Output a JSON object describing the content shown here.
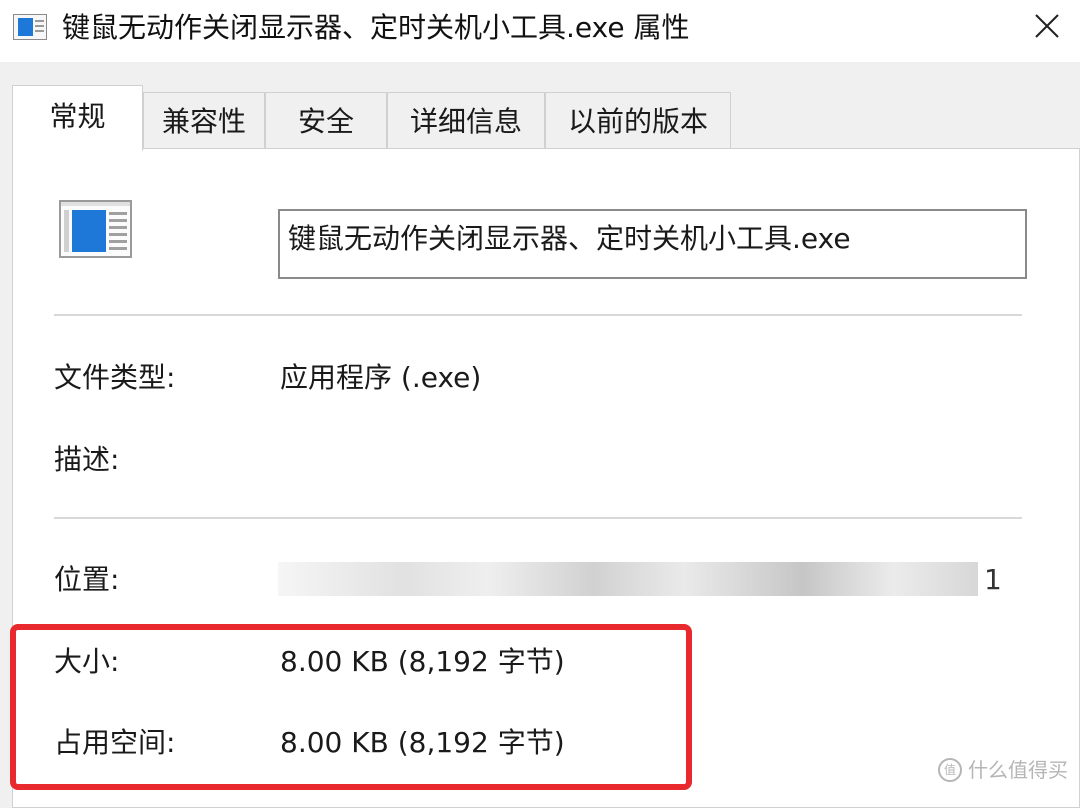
{
  "window": {
    "title": "键鼠无动作关闭显示器、定时关机小工具.exe 属性",
    "close_icon": "close-icon"
  },
  "tabs": [
    {
      "label": "常规",
      "active": true
    },
    {
      "label": "兼容性",
      "active": false
    },
    {
      "label": "安全",
      "active": false
    },
    {
      "label": "详细信息",
      "active": false
    },
    {
      "label": "以前的版本",
      "active": false
    }
  ],
  "general": {
    "file_name": "键鼠无动作关闭显示器、定时关机小工具.exe",
    "file_type_label": "文件类型:",
    "file_type_value": "应用程序 (.exe)",
    "description_label": "描述:",
    "location_label": "位置:",
    "location_suffix": "1",
    "size_label": "大小:",
    "size_value": "8.00 KB (8,192 字节)",
    "size_on_disk_label": "占用空间:",
    "size_on_disk_value": "8.00 KB (8,192 字节)"
  },
  "annotation": {
    "highlight_color": "#e8292e"
  },
  "watermark": {
    "text": "什么值得买",
    "mark": "值"
  }
}
